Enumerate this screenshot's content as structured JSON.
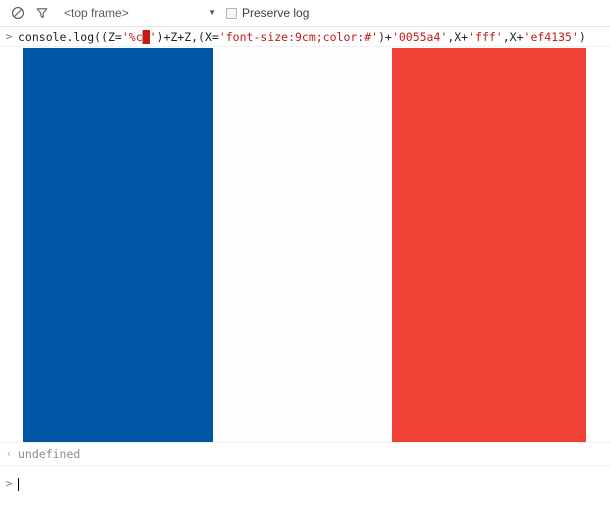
{
  "toolbar": {
    "clear_icon": "clear-console-icon",
    "filter_icon": "filter-funnel-icon",
    "frame_selector": {
      "value": "<top frame>",
      "arrow": "▼"
    },
    "preserve_log": {
      "label": "Preserve log",
      "checked": false
    }
  },
  "console": {
    "command": {
      "gutter": ">",
      "parts": {
        "p1": "console.log((Z=",
        "s1": "'%c",
        "block": "█",
        "s1b": "'",
        "p2": ")+Z+Z,(X=",
        "s2": "'font-size:9cm;color:#'",
        "p3": ")+",
        "s3": "'0055a4'",
        "p4": ",X+",
        "s4": "'fff'",
        "p5": ",X+",
        "s5": "'ef4135'",
        "p6": ")"
      },
      "full_text": "console.log((Z='%c█')+Z+Z,(X='font-size:9cm;color:#')+'0055a4',X+'fff',X+'ef4135')"
    },
    "output": {
      "name": "french-flag-blocks",
      "bands": [
        {
          "name": "blue-band",
          "color": "#0055a4"
        },
        {
          "name": "white-band",
          "color": "#fdfdfd"
        },
        {
          "name": "red-band",
          "color": "#ef4135"
        }
      ]
    },
    "result": {
      "gutter": "‹",
      "value": "undefined"
    },
    "prompt": {
      "gutter": ">",
      "value": "",
      "placeholder": ""
    }
  },
  "colors": {
    "blue": "#0055a4",
    "white": "#fdfdfd",
    "red": "#ef4135",
    "string_token": "#c41a16",
    "prompt_arrow": "#6e7ea8",
    "result_arrow": "#a9b2c4",
    "result_text": "#8c8c8c"
  }
}
